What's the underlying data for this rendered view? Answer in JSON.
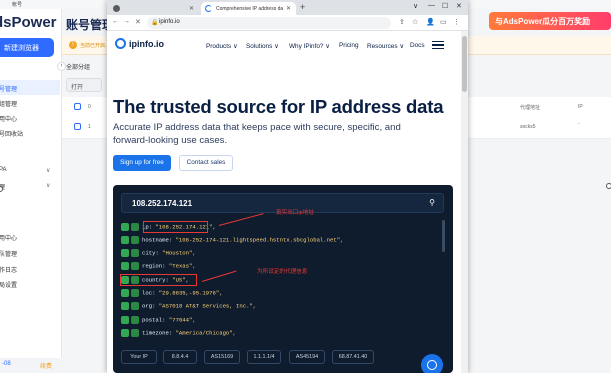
{
  "background_app": {
    "titlebar_text": "帐号",
    "logo": "dsPower",
    "new_browser_label": "新建浏览器",
    "page_title": "账号管理",
    "notice_text": "当前已开启...",
    "group_label": "全部分组",
    "open_label": "打开",
    "nav_items": [
      "号管理",
      "组管理",
      "用中心",
      "号回收站",
      "PA",
      "理",
      "用中心",
      "队管理",
      "作日志",
      "局设置"
    ],
    "rows": [
      {
        "index": "0",
        "cell": ""
      },
      {
        "index": "1",
        "cell": "socks5"
      }
    ],
    "column_headers": [
      "代理地址",
      "IP"
    ],
    "bottom_text": "-08",
    "bottom_link": "续费",
    "banner_text": "与AdsPower瓜分百万奖励"
  },
  "browser": {
    "tabs": [
      {
        "title": "",
        "state": "inactive"
      },
      {
        "title": "Comprehensive IP address da",
        "state": "active"
      }
    ],
    "new_tab_label": "+",
    "url": "ipinfo.io"
  },
  "ipinfo": {
    "logo_text": "ipinfo.io",
    "nav": [
      "Products ∨",
      "Solutions ∨",
      "Why IPinfo? ∨",
      "Pricing",
      "Resources ∨",
      "Docs"
    ],
    "hero_title": "The trusted source for IP address data",
    "hero_sub": "Accurate IP address data that keeps pace with secure, specific, and forward-looking use cases.",
    "cta_primary": "Sign up for free",
    "cta_secondary": "Contact sales",
    "search_ip": "108.252.174.121",
    "json_lines": [
      {
        "key": "ip",
        "value": "\"108.252.174.121\","
      },
      {
        "key": "hostname",
        "value": "\"108-252-174-121.lightspeed.hstntx.sbcglobal.net\","
      },
      {
        "key": "city",
        "value": "\"Houston\","
      },
      {
        "key": "region",
        "value": "\"Texas\","
      },
      {
        "key": "country",
        "value": "\"US\","
      },
      {
        "key": "loc",
        "value": "\"29.8635,-95.1976\","
      },
      {
        "key": "org",
        "value": "\"AS7018 AT&T Services, Inc.\","
      },
      {
        "key": "postal",
        "value": "\"77044\","
      },
      {
        "key": "timezone",
        "value": "\"America/Chicago\","
      }
    ],
    "chips": [
      "Your IP",
      "8.8.4.4",
      "AS15169",
      "1.1.1.1/4",
      "AS45194",
      "68.87.41.40"
    ]
  },
  "annotations": {
    "ip_note": "真实出口ip地址",
    "country_note": "为所设定的代理信息"
  },
  "colors": {
    "ipinfo_blue": "#1a73e8",
    "ipinfo_navy": "#0a1f44",
    "demo_bg": "#0f1c2e",
    "annotation_red": "#e53935",
    "adspower_blue": "#2f6bff"
  }
}
